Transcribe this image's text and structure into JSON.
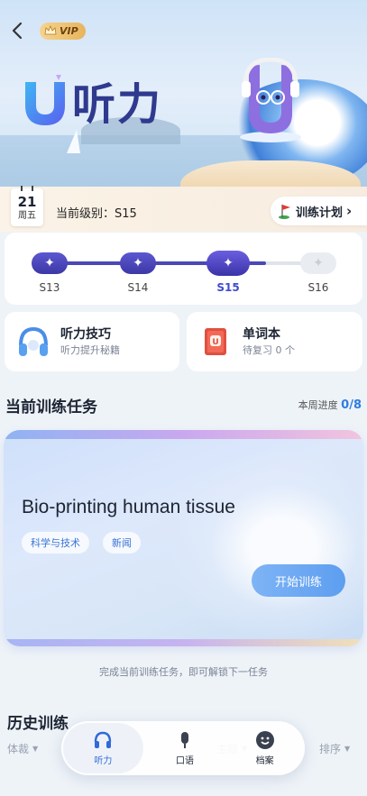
{
  "header": {
    "vip_label": "VIP",
    "brand_title": "听力"
  },
  "level_bar": {
    "calendar_day": "21",
    "calendar_weekday": "周五",
    "current_level_text": "当前级别：S15",
    "train_plan_label": "训练计划"
  },
  "level_progress": {
    "levels": [
      "S13",
      "S14",
      "S15",
      "S16"
    ],
    "current_level": "S15",
    "filled_fraction": 0.8
  },
  "features": [
    {
      "title": "听力技巧",
      "subtitle": "听力提升秘籍",
      "icon": "headphones-icon"
    },
    {
      "title": "单词本",
      "subtitle": "待复习 0 个",
      "icon": "vocabulary-book-icon"
    }
  ],
  "tasks": {
    "section_title": "当前训练任务",
    "week_progress_label": "本周进度",
    "week_progress_value": "0/8",
    "card": {
      "title": "Bio-printing human tissue",
      "tags": [
        "科学与技术",
        "新闻"
      ],
      "start_label": "开始训练"
    },
    "unlock_hint": "完成当前训练任务，即可解锁下一任务"
  },
  "history": {
    "title": "历史训练",
    "filters": [
      "体裁",
      "主题",
      "排序"
    ]
  },
  "bottom_nav": [
    {
      "label": "听力",
      "icon": "headphones-icon",
      "active": true
    },
    {
      "label": "口语",
      "icon": "microphone-icon",
      "active": false
    },
    {
      "label": "档案",
      "icon": "profile-icon",
      "active": false
    }
  ],
  "colors": {
    "accent": "#3f4bd0",
    "track_fill": "#4b48b8",
    "start_button": "#6aa7f2",
    "nav_active": "#2f6ad8"
  }
}
